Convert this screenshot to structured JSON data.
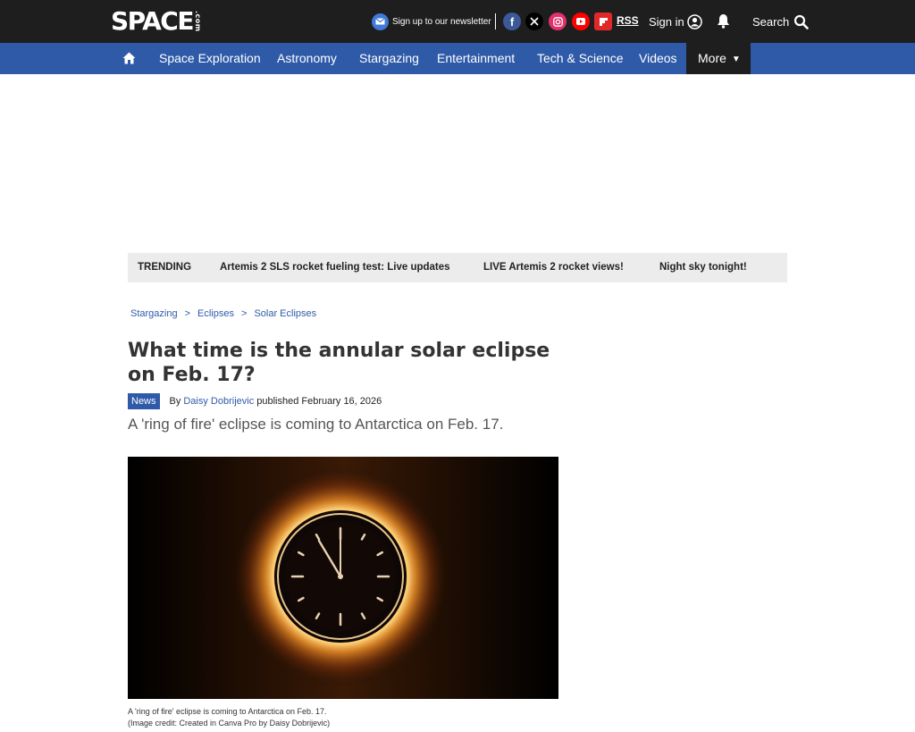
{
  "header": {
    "logo_main": "SPACE",
    "logo_suffix": ".com",
    "newsletter_label": "Sign up to our newsletter",
    "social": [
      {
        "name": "facebook",
        "glyph": "f",
        "color": "#3b5998"
      },
      {
        "name": "x",
        "glyph": "𝕏",
        "color": "#000000"
      },
      {
        "name": "instagram",
        "glyph": "◎",
        "color": "#e1306c"
      },
      {
        "name": "youtube",
        "glyph": "▶",
        "color": "#ff0000"
      },
      {
        "name": "flipboard",
        "glyph": "f",
        "color": "#e12828"
      }
    ],
    "rss_label": "RSS",
    "signin_label": "Sign in",
    "search_label": "Search"
  },
  "nav": {
    "items": [
      "Space Exploration",
      "Astronomy",
      "Stargazing",
      "Entertainment",
      "Tech & Science",
      "Videos"
    ],
    "more_label": "More"
  },
  "trending": {
    "label": "TRENDING",
    "links": [
      "Artemis 2 SLS rocket fueling test: Live updates",
      "LIVE Artemis 2 rocket views!",
      "Night sky tonight!"
    ]
  },
  "breadcrumb": [
    "Stargazing",
    "Eclipses",
    "Solar Eclipses"
  ],
  "article": {
    "title": "What time is the annular solar eclipse on Feb. 17?",
    "badge": "News",
    "by": "By",
    "author": "Daisy Dobrijevic",
    "published": "published February 16, 2026",
    "strapline": "A 'ring of fire' eclipse is coming to Antarctica on Feb. 17.",
    "caption": "A 'ring of fire' eclipse is coming to Antarctica on Feb. 17.",
    "credit": "(Image credit: Created in Canva Pro by Daisy Dobrijevic)"
  },
  "colors": {
    "header_bg": "#1e1e1e",
    "nav_bg": "#2f5aa8",
    "accent": "#2f5aa8"
  }
}
